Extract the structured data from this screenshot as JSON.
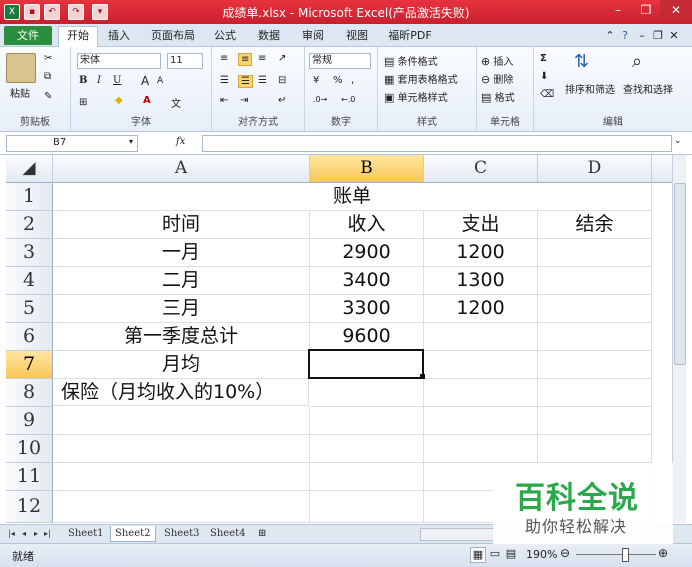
{
  "window": {
    "title": "成绩单.xlsx - Microsoft Excel(产品激活失败)"
  },
  "tabs": [
    "文件",
    "开始",
    "插入",
    "页面布局",
    "公式",
    "数据",
    "审阅",
    "视图",
    "福昕PDF"
  ],
  "ribbon": {
    "clipboard": {
      "label": "剪贴板",
      "paste": "粘贴"
    },
    "font": {
      "label": "字体",
      "name": "宋体",
      "size": "11",
      "bold": "B",
      "italic": "I",
      "underline": "U",
      "grow": "A",
      "shrink": "A",
      "fontcolor": "A",
      "phonetic": "文"
    },
    "align": {
      "label": "对齐方式"
    },
    "number": {
      "label": "数字",
      "format": "常规",
      "percent": "%",
      "comma": ",",
      "currency": "¥"
    },
    "styles": {
      "label": "样式",
      "cond": "条件格式",
      "table": "套用表格格式",
      "cell": "单元格样式"
    },
    "cells": {
      "label": "单元格",
      "insert": "插入",
      "delete": "删除",
      "format": "格式"
    },
    "edit": {
      "label": "编辑",
      "sort": "排序和筛选",
      "find": "查找和选择"
    }
  },
  "formula": {
    "namebox": "B7",
    "fx": "fx",
    "content": ""
  },
  "columns": [
    "A",
    "B",
    "C",
    "D"
  ],
  "rows": [
    "1",
    "2",
    "3",
    "4",
    "5",
    "6",
    "7",
    "8",
    "9",
    "10",
    "11",
    "12"
  ],
  "cells": {
    "r1": "账单",
    "r2": [
      "时间",
      "收入",
      "支出",
      "结余"
    ],
    "r3": [
      "一月",
      "2900",
      "1200"
    ],
    "r4": [
      "二月",
      "3400",
      "1300"
    ],
    "r5": [
      "三月",
      "3300",
      "1200"
    ],
    "r6": [
      "第一季度总计",
      "9600"
    ],
    "r7": [
      "月均"
    ],
    "r8": [
      "保险（月均收入的10%）"
    ]
  },
  "sheets": [
    "Sheet1",
    "Sheet2",
    "Sheet3",
    "Sheet4"
  ],
  "status": {
    "ready": "就绪",
    "zoom": "190%"
  },
  "watermark": {
    "brand": "百科全说",
    "slogan": "助你轻松解决"
  },
  "colors": {
    "titlebar": "#d9252f",
    "file_tab": "#2a8e3e",
    "select_header": "#f9c658",
    "watermark": "#2aa84a"
  }
}
